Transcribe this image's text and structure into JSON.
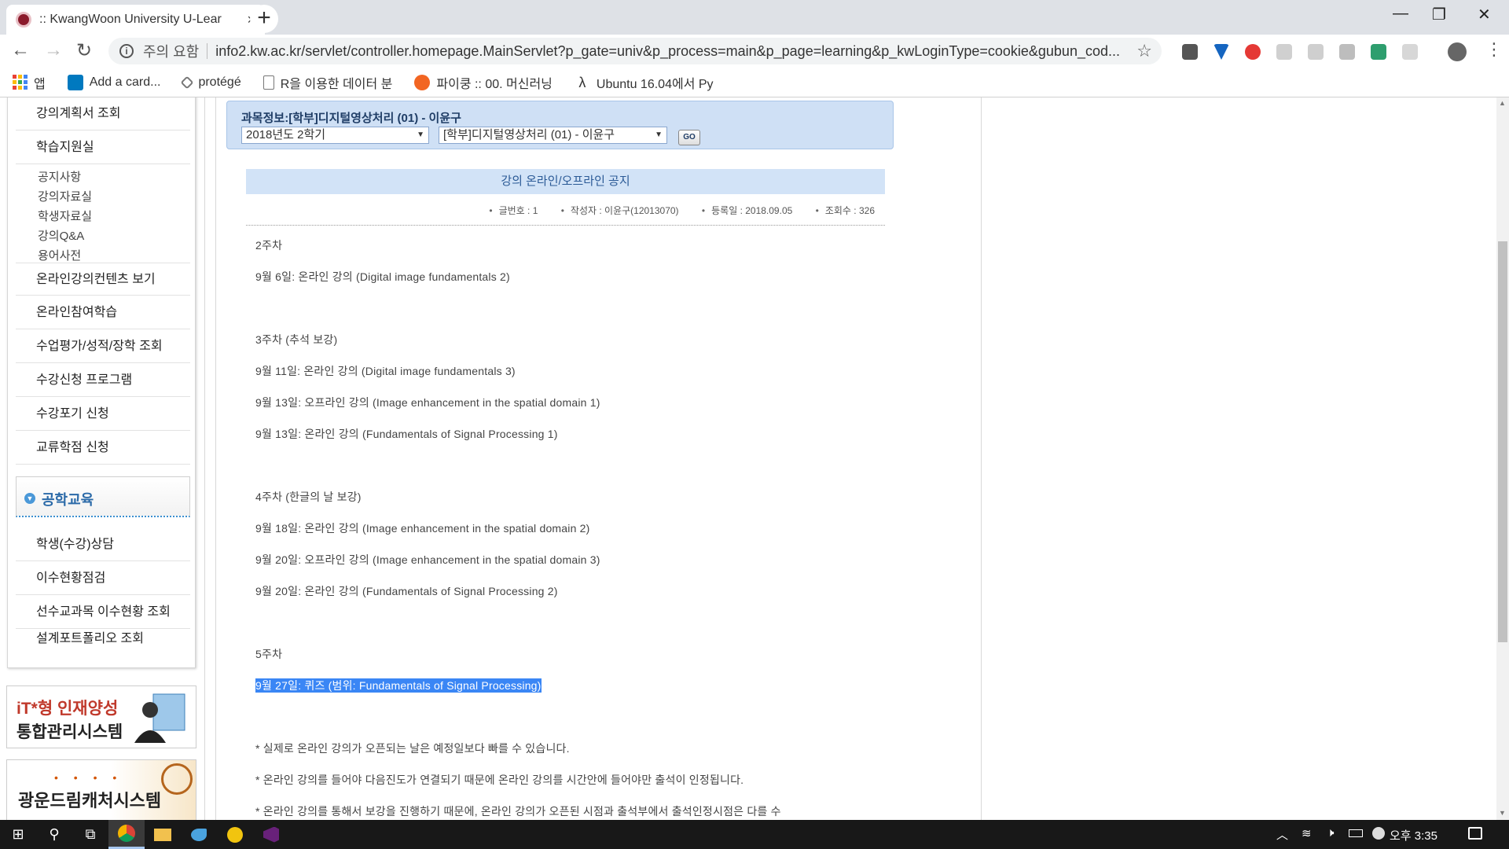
{
  "browser": {
    "tab_title": ":: KwangWoon University U-Lear",
    "tab_close": "×",
    "new_tab": "+",
    "window_controls": {
      "minimize": "—",
      "maximize": "❐",
      "close": "✕"
    },
    "nav": {
      "back": "←",
      "forward": "→",
      "reload": "↻"
    },
    "security_label": "주의 요함",
    "url": "info2.kw.ac.kr/servlet/controller.homepage.MainServlet?p_gate=univ&p_process=main&p_page=learning&p_kwLoginType=cookie&gubun_cod...",
    "star": "☆",
    "bookmarks": [
      {
        "label": "앱",
        "icon": "apps-grid-icon"
      },
      {
        "label": "Add a card...",
        "icon": "trello-icon"
      },
      {
        "label": "protégé",
        "icon": "protege-icon"
      },
      {
        "label": "R을 이용한 데이터 분",
        "icon": "page-icon"
      },
      {
        "label": "파이쿵 :: 00. 머신러닝",
        "icon": "pycoong-icon"
      },
      {
        "label": "Ubuntu 16.04에서 Py",
        "icon": "lambda-icon"
      }
    ]
  },
  "sidebar": {
    "menu_top": "강의계획서 조회",
    "study_room": "학습지원실",
    "sub_items": [
      "공지사항",
      "강의자료실",
      "학생자료실",
      "강의Q&A",
      "용어사전"
    ],
    "menu": [
      "온라인강의컨텐츠 보기",
      "온라인참여학습",
      "수업평가/성적/장학 조회",
      "수강신청 프로그램",
      "수강포기 신청",
      "교류학점 신청"
    ],
    "eng_section": "공학교육",
    "eng_items": [
      "학생(수강)상담",
      "이수현황점검",
      "선수교과목 이수현황 조회",
      "설계포트폴리오 조회"
    ],
    "banner_it": {
      "line1": "iT*형 인재양성",
      "line2": "통합관리시스템"
    },
    "banner_dream": {
      "dots": "• • • •",
      "text": "광운드림캐처시스템"
    }
  },
  "course": {
    "title": "과목정보:[학부]디지털영상처리 (01) - 이윤구",
    "semester": "2018년도 2학기",
    "subject": "[학부]디지털영상처리 (01) - 이윤구",
    "go": "GO"
  },
  "notice": {
    "heading": "강의 온라인/오프라인 공지",
    "meta": {
      "number": "글번호 : 1",
      "author": "작성자 : 이윤구(12013070)",
      "date": "등록일 : 2018.09.05",
      "views": "조회수 : 326"
    },
    "lines": [
      "2주차",
      "9월 6일: 온라인 강의 (Digital image fundamentals 2)",
      "3주차 (추석 보강)",
      "9월 11일: 온라인 강의 (Digital image fundamentals 3)",
      "9월 13일: 오프라인 강의 (Image enhancement in the spatial domain 1)",
      "9월 13일: 온라인 강의 (Fundamentals of Signal Processing 1)",
      "4주차 (한글의 날 보강)",
      "9월 18일: 온라인 강의 (Image enhancement in the spatial domain 2)",
      "9월 20일: 오프라인 강의 (Image enhancement in the spatial domain 3)",
      "9월 20일: 온라인 강의 (Fundamentals of Signal Processing 2)",
      "5주차",
      "9월 27일: 퀴즈 (범위: Fundamentals of Signal Processing)",
      "* 실제로 온라인 강의가 오픈되는 날은 예정일보다 빠를 수 있습니다.",
      "* 온라인 강의를 들어야 다음진도가 연결되기 때문에 온라인 강의를 시간안에 들어야만 출석이 인정됩니다.",
      "* 온라인 강의를 통해서 보강을 진행하기 때문에, 온라인 강의가 오픈된 시점과 출석부에서 출석인정시점은 다를 수"
    ]
  },
  "taskbar": {
    "clock": "오후 3:35",
    "start": "⊞",
    "search": "⚲",
    "task_view": "⧉"
  },
  "colors": {
    "highlight": "#3a86f5",
    "notice_head_bg": "#d2e3f7",
    "course_box_bg": "#cfe0f5"
  }
}
